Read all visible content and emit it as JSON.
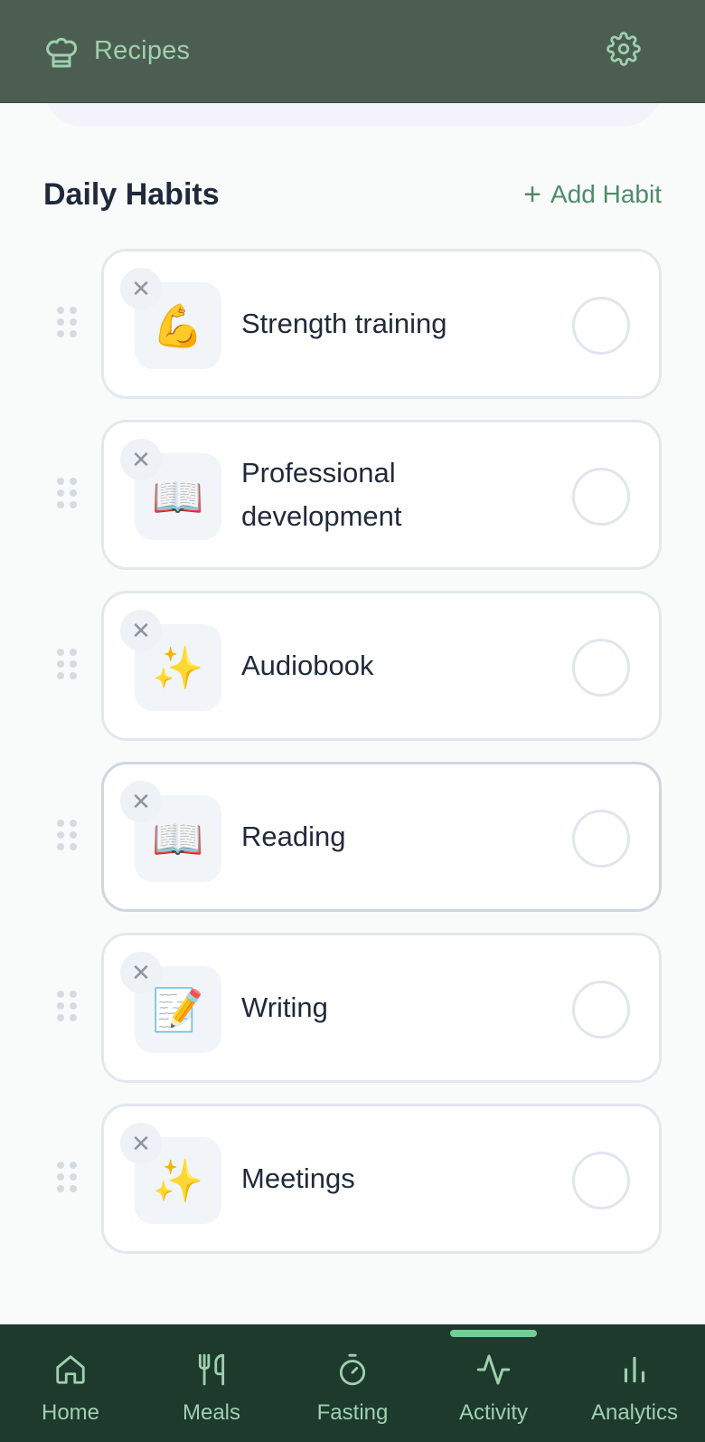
{
  "header": {
    "title": "Recipes",
    "brand_icon": "chef-hat-icon",
    "settings_icon": "gear-icon"
  },
  "section": {
    "title": "Daily Habits",
    "add_label": "Add Habit",
    "add_icon": "+"
  },
  "habits": [
    {
      "name": "Strength training",
      "emoji": "💪",
      "checked": false
    },
    {
      "name": "Professional development",
      "emoji": "📖",
      "checked": false
    },
    {
      "name": "Audiobook",
      "emoji": "✨",
      "checked": false
    },
    {
      "name": "Reading",
      "emoji": "📖",
      "checked": false
    },
    {
      "name": "Writing",
      "emoji": "📝",
      "checked": false
    },
    {
      "name": "Meetings",
      "emoji": "✨",
      "checked": false
    }
  ],
  "remove_glyph": "✕",
  "nav": {
    "items": [
      {
        "label": "Home",
        "icon": "home-icon"
      },
      {
        "label": "Meals",
        "icon": "utensils-icon"
      },
      {
        "label": "Fasting",
        "icon": "stopwatch-icon"
      },
      {
        "label": "Activity",
        "icon": "activity-icon"
      },
      {
        "label": "Analytics",
        "icon": "bar-chart-icon"
      }
    ],
    "active": "Activity"
  },
  "colors": {
    "header_bg": "#4b5e51",
    "nav_bg": "#1d3a2d",
    "accent": "#9fd0ae",
    "add_link": "#4f8b68",
    "active_indicator": "#6fcf97"
  }
}
